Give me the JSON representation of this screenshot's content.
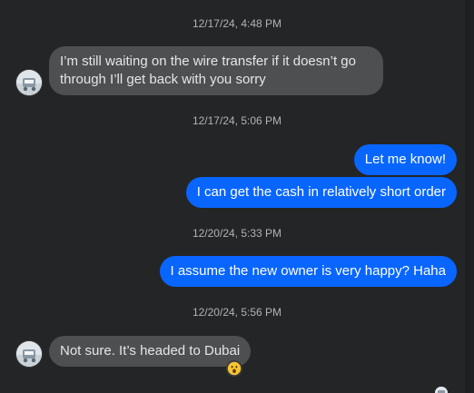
{
  "timestamps": {
    "t1": "12/17/24, 4:48 PM",
    "t2": "12/17/24, 5:06 PM",
    "t3": "12/20/24, 5:33 PM",
    "t4": "12/20/24, 5:56 PM"
  },
  "messages": [
    {
      "direction": "incoming",
      "text": "I’m still waiting on the wire transfer if it doesn’t go through I’ll get back with you sorry"
    },
    {
      "direction": "outgoing",
      "text": "Let me know!"
    },
    {
      "direction": "outgoing",
      "text": "I can get the cash in relatively short order"
    },
    {
      "direction": "outgoing",
      "text": "I assume the new owner is very happy? Haha"
    },
    {
      "direction": "incoming",
      "text": "Not sure. It’s headed to Dubai",
      "reaction": "surprised-face-emoji"
    }
  ],
  "colors": {
    "background": "#242526",
    "incoming_bubble": "#4e4f50",
    "outgoing_bubble": "#0866ff",
    "timestamp_text": "#b0b3b8"
  }
}
